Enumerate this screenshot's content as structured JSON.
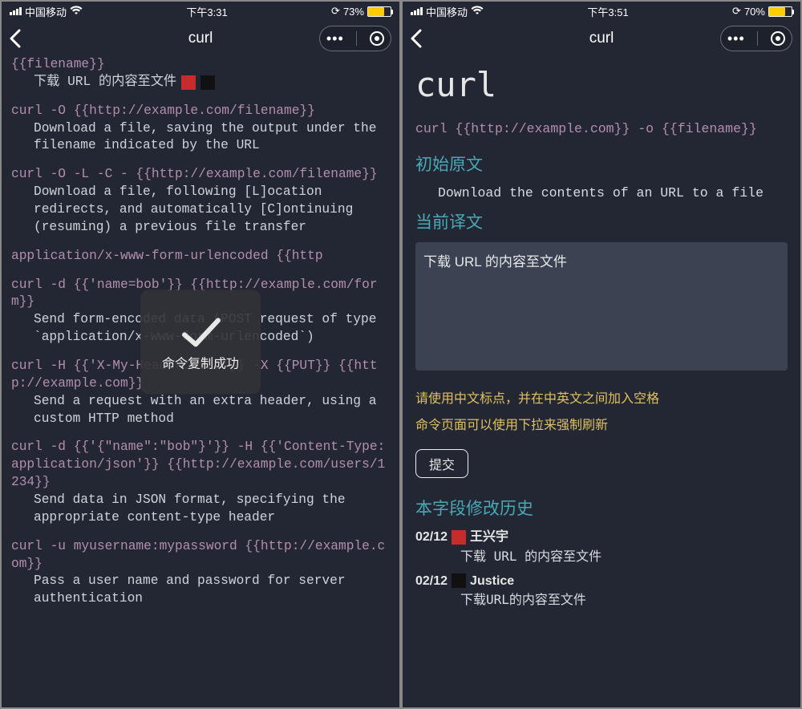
{
  "left": {
    "status": {
      "carrier": "中国移动",
      "time": "下午3:31",
      "battery_pct": "73%",
      "battery_fill": "73%"
    },
    "title": "curl",
    "partial_top": "{{filename}}",
    "toast": "命令复制成功",
    "blocks": [
      {
        "cmd_pre": "",
        "cmd": "",
        "desc": "下载 URL 的内容至文件",
        "has_avatars": true
      },
      {
        "cmd": "curl -O {{http://example.com/filename}}",
        "desc": "Download a file, saving the output under the filename indicated by the URL"
      },
      {
        "cmd": "curl -O -L -C - {{http://example.com/filename}}",
        "desc": "Download a file, following [L]ocation redirects, and automatically [C]ontinuing (resuming) a previous file transfer"
      },
      {
        "cmd": "application/x-www-form-urlencoded {{http",
        "desc": ""
      },
      {
        "cmd": "curl -d {{'name=bob'}} {{http://example.com/form}}",
        "desc": "Send form-encoded data (POST request of type `application/x-www-form-urlencoded`)"
      },
      {
        "cmd": "curl -H {{'X-My-Header: 123'}} -X {{PUT}} {{http://example.com}}",
        "desc": "Send a request with an extra header, using a custom HTTP method"
      },
      {
        "cmd": "curl -d {{'{\"name\":\"bob\"}'}} -H {{'Content-Type: application/json'}} {{http://example.com/users/1234}}",
        "desc": "Send data in JSON format, specifying the appropriate content-type header"
      },
      {
        "cmd": "curl -u myusername:mypassword {{http://example.com}}",
        "desc": "Pass a user name and password for server authentication"
      }
    ]
  },
  "right": {
    "status": {
      "carrier": "中国移动",
      "time": "下午3:51",
      "battery_pct": "70%",
      "battery_fill": "70%"
    },
    "title": "curl",
    "h1": "curl",
    "cmd": "curl {{http://example.com}} -o {{filename}}",
    "section_original": "初始原文",
    "original_text": "Download the contents of an URL to a file",
    "section_translation": "当前译文",
    "translation_value": "下载 URL 的内容至文件",
    "hint1": "请使用中文标点，并在中英文之间加入空格",
    "hint2": "命令页面可以使用下拉来强制刷新",
    "submit": "提交",
    "section_history": "本字段修改历史",
    "history": [
      {
        "date": "02/12",
        "avatar": "red",
        "user": "王兴宇",
        "text": "下载 URL 的内容至文件"
      },
      {
        "date": "02/12",
        "avatar": "dark",
        "user": "Justice",
        "text": "下载URL的内容至文件"
      }
    ]
  }
}
